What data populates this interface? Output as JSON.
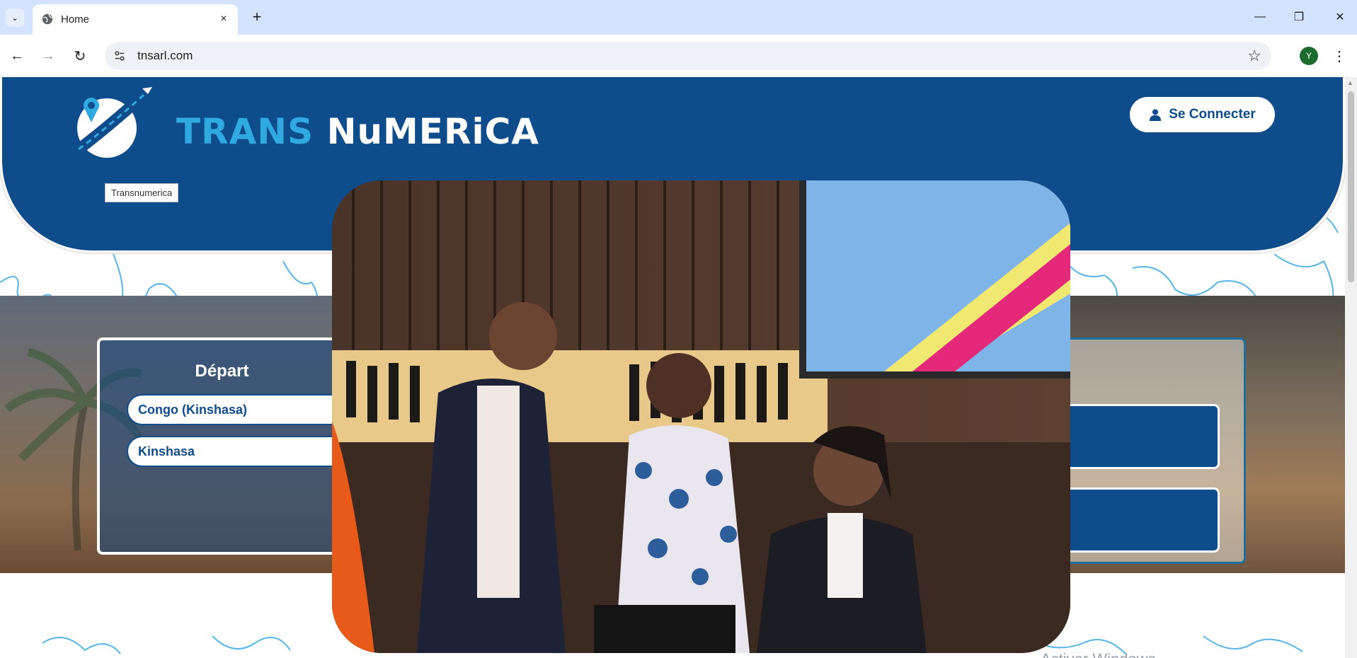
{
  "browser": {
    "tab": {
      "title": "Home",
      "close_icon": "×"
    },
    "new_tab_icon": "+",
    "tab_list_icon": "⌄",
    "window_controls": {
      "minimize": "—",
      "restore": "❐",
      "close": "✕"
    },
    "nav": {
      "back": "←",
      "forward": "→",
      "reload": "↻"
    },
    "address": {
      "url": "tnsarl.com"
    },
    "bookmark_icon": "☆",
    "profile_initial": "Y",
    "menu_icon": "⋮"
  },
  "site": {
    "brand": {
      "word1": "TRANS",
      "word2": "NuMERiCA"
    },
    "logo_tooltip": "Transnumerica",
    "login_label": "Se Connecter",
    "colors": {
      "primary": "#0e4c8c",
      "accent": "#2fa9e0"
    }
  },
  "search": {
    "title": "Départ",
    "country_value": "Congo (Kinshasa)",
    "city_value": "Kinshasa"
  },
  "footer_watermark": "Activer Windows"
}
